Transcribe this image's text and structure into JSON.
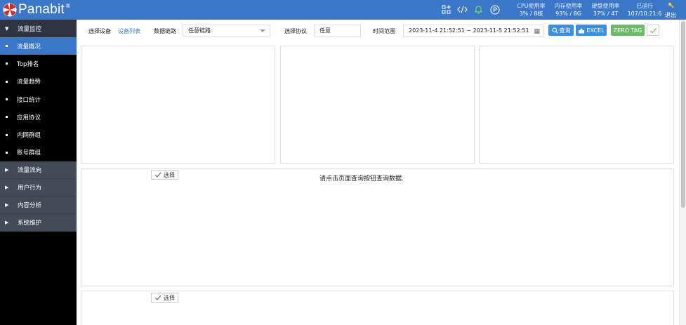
{
  "header": {
    "brand": "Panabit",
    "brand_mark": "®",
    "icons": [
      "dashboard-plus-icon",
      "code-icon",
      "bell-icon",
      "p-circle-icon"
    ],
    "stats": [
      {
        "label": "CPU使用率",
        "value": "3% / 8核"
      },
      {
        "label": "内存使用率",
        "value": "93% / 8G"
      },
      {
        "label": "硬盘使用率",
        "value": "37% / 4T"
      },
      {
        "label": "已运行",
        "value": "107/10:21:6"
      }
    ],
    "logout": "退出"
  },
  "sidebar": {
    "groups": [
      {
        "label": "流量监控",
        "expanded": true,
        "items": [
          {
            "label": "流量概况",
            "active": true
          },
          {
            "label": "Top排名",
            "active": false
          },
          {
            "label": "流量趋势",
            "active": false
          },
          {
            "label": "接口统计",
            "active": false
          },
          {
            "label": "应用协议",
            "active": false
          },
          {
            "label": "内网群组",
            "active": false
          },
          {
            "label": "账号群组",
            "active": false
          }
        ]
      },
      {
        "label": "流量流向",
        "expanded": false
      },
      {
        "label": "用户行为",
        "expanded": false
      },
      {
        "label": "内容分析",
        "expanded": false
      },
      {
        "label": "系统维护",
        "expanded": false
      }
    ]
  },
  "filter": {
    "device_label": "选择设备",
    "device_link": "设备列表",
    "link_label": "数据链路",
    "link_value": "任意链路",
    "protocol_label": "选择协议",
    "protocol_value": "任意",
    "time_label": "时间范围",
    "time_value": "2023-11-4 21:52:51 ~ 2023-11-5 21:52:51",
    "query_button": "查询",
    "excel_button": "EXCEL",
    "zero_tag_button": "ZERO TAG"
  },
  "panels": {
    "select_button": "选择",
    "empty_hint": "请点击页面查询按钮查询数据."
  },
  "colors": {
    "header": "#3a77c9",
    "active": "#3a77c9",
    "sidebar_bg": "#000000",
    "sidebar_group": "#2e3441",
    "button_blue": "#3a8fe0",
    "button_green": "#6cba6a"
  }
}
